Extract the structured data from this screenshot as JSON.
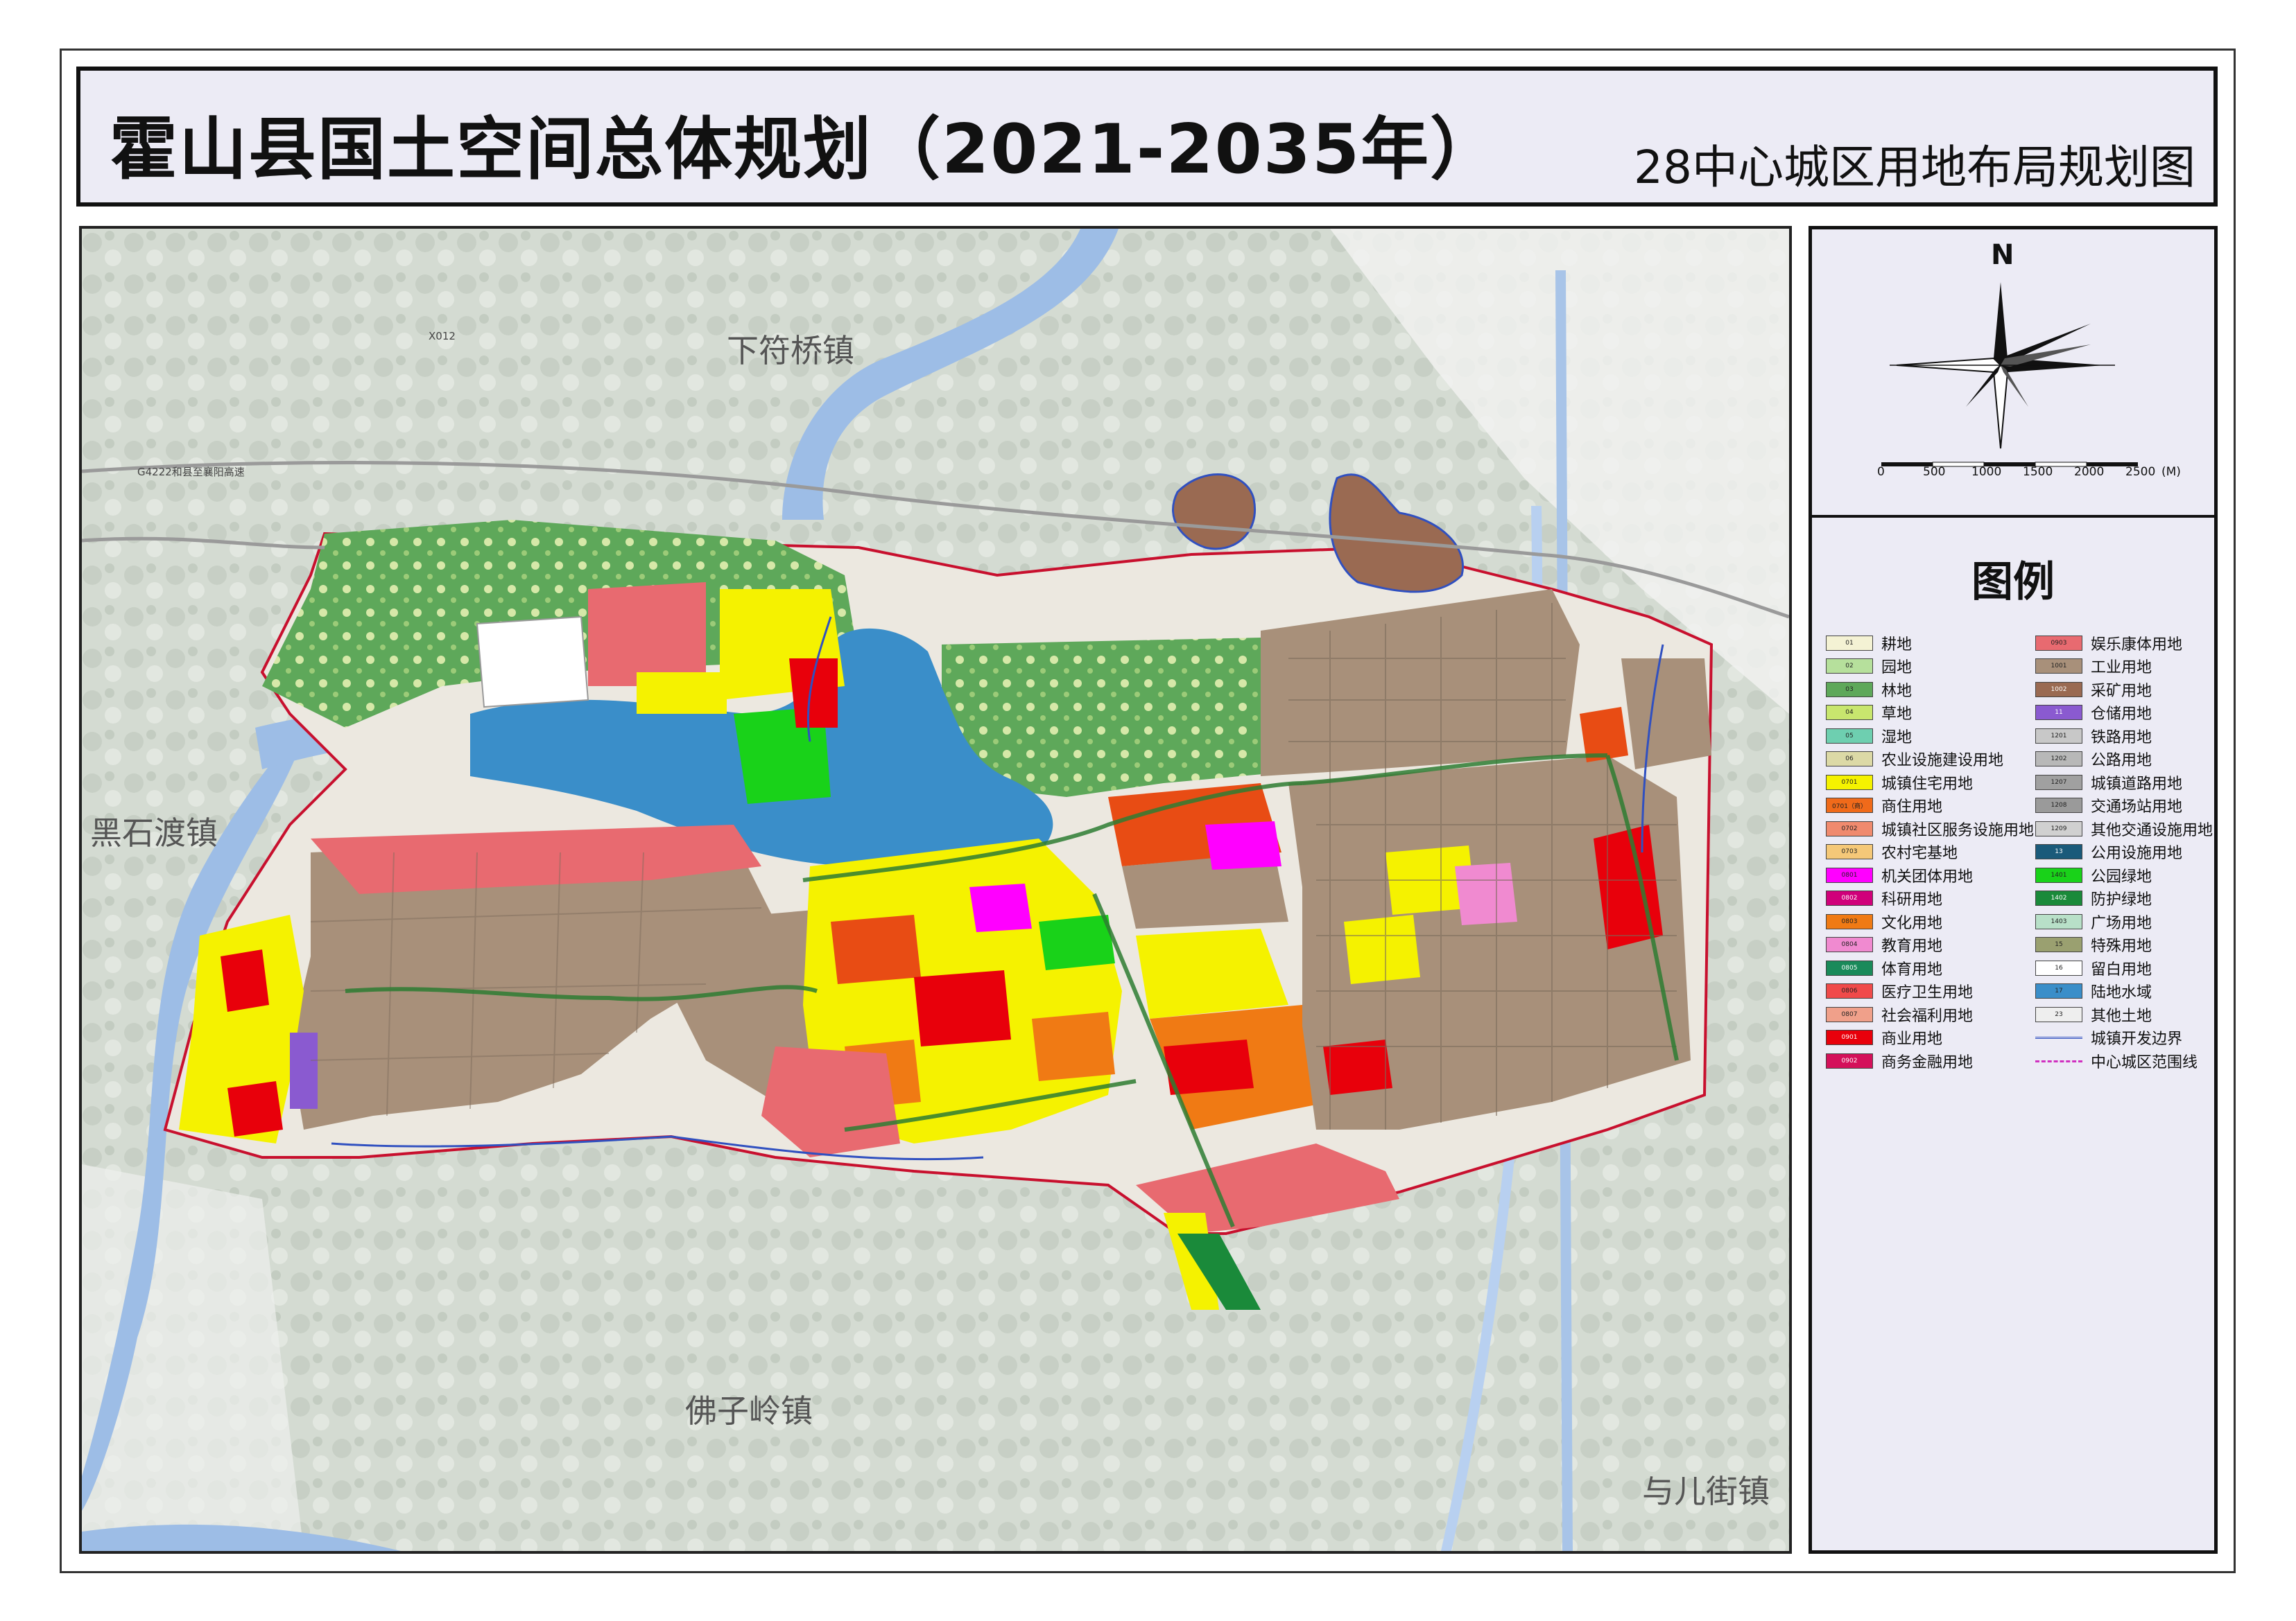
{
  "header": {
    "title": "霍山县国土空间总体规划（2021-2035年）",
    "subtitle": "28中心城区用地布局规划图"
  },
  "compass": {
    "north": "N"
  },
  "scale_bar": {
    "ticks": [
      "0",
      "500",
      "1000",
      "1500",
      "2000",
      "2500"
    ],
    "unit": "(M)"
  },
  "map": {
    "towns": [
      {
        "name": "下符桥镇"
      },
      {
        "name": "黑石渡镇"
      },
      {
        "name": "佛子岭镇"
      },
      {
        "name": "与儿街镇"
      }
    ],
    "roads": [
      {
        "name": "X012"
      },
      {
        "name": "G4222和县至襄阳高速"
      }
    ],
    "colors": {
      "water": "#9dbde6",
      "reservoir": "#3a8ec9",
      "forest": "#5ea85a",
      "industrial": "#a8907a",
      "residential": "#f5f200",
      "commercial": "#e8000b",
      "mixed": "#e84c14",
      "park": "#19d219",
      "boundary": "#c8102e",
      "road_outline": "#2e7d32",
      "dev_boundary": "#3050c0"
    }
  },
  "legend": {
    "title": "图例",
    "left": [
      {
        "code": "01",
        "label": "耕地",
        "color": "#f4f2d4"
      },
      {
        "code": "02",
        "label": "园地",
        "color": "#b6e09c"
      },
      {
        "code": "03",
        "label": "林地",
        "color": "#5ea85a"
      },
      {
        "code": "04",
        "label": "草地",
        "color": "#c8e66e"
      },
      {
        "code": "05",
        "label": "湿地",
        "color": "#6ecfb0"
      },
      {
        "code": "06",
        "label": "农业设施建设用地",
        "color": "#dcd9a6"
      },
      {
        "code": "0701",
        "label": "城镇住宅用地",
        "color": "#f5f200"
      },
      {
        "code": "0701（商）",
        "label": "商住用地",
        "color": "#f06a1a"
      },
      {
        "code": "0702",
        "label": "城镇社区服务设施用地",
        "color": "#f08a6e"
      },
      {
        "code": "0703",
        "label": "农村宅基地",
        "color": "#f5c878"
      },
      {
        "code": "0801",
        "label": "机关团体用地",
        "color": "#ff00ff"
      },
      {
        "code": "0802",
        "label": "科研用地",
        "color": "#d0007a"
      },
      {
        "code": "0803",
        "label": "文化用地",
        "color": "#f07a14"
      },
      {
        "code": "0804",
        "label": "教育用地",
        "color": "#f08ad0"
      },
      {
        "code": "0805",
        "label": "体育用地",
        "color": "#1a8a5a"
      },
      {
        "code": "0806",
        "label": "医疗卫生用地",
        "color": "#f04a4a"
      },
      {
        "code": "0807",
        "label": "社会福利用地",
        "color": "#f0a08a"
      },
      {
        "code": "0901",
        "label": "商业用地",
        "color": "#e8000b"
      },
      {
        "code": "0902",
        "label": "商务金融用地",
        "color": "#d4105a"
      }
    ],
    "right": [
      {
        "code": "0903",
        "label": "娱乐康体用地",
        "color": "#e86a70"
      },
      {
        "code": "1001",
        "label": "工业用地",
        "color": "#a8907a"
      },
      {
        "code": "1002",
        "label": "采矿用地",
        "color": "#9a6a52"
      },
      {
        "code": "11",
        "label": "仓储用地",
        "color": "#8a5ad0"
      },
      {
        "code": "1201",
        "label": "铁路用地",
        "color": "#c8c8c8"
      },
      {
        "code": "1202",
        "label": "公路用地",
        "color": "#b8b8b8"
      },
      {
        "code": "1207",
        "label": "城镇道路用地",
        "color": "#a0a0a0"
      },
      {
        "code": "1208",
        "label": "交通场站用地",
        "color": "#9a9a9a"
      },
      {
        "code": "1209",
        "label": "其他交通设施用地",
        "color": "#d0d0d0"
      },
      {
        "code": "13",
        "label": "公用设施用地",
        "color": "#1a5a7a"
      },
      {
        "code": "1401",
        "label": "公园绿地",
        "color": "#19d219"
      },
      {
        "code": "1402",
        "label": "防护绿地",
        "color": "#1a8a3a"
      },
      {
        "code": "1403",
        "label": "广场用地",
        "color": "#b8e0c8"
      },
      {
        "code": "15",
        "label": "特殊用地",
        "color": "#9aa070"
      },
      {
        "code": "16",
        "label": "留白用地",
        "color": "#ffffff"
      },
      {
        "code": "17",
        "label": "陆地水域",
        "color": "#3a8ec9"
      },
      {
        "code": "23",
        "label": "其他土地",
        "color": "#eeeeee"
      },
      {
        "code": "",
        "label": "城镇开发边界",
        "color": "#3050c0"
      },
      {
        "code": "",
        "label": "中心城区范围线",
        "color": "#d030c0"
      }
    ]
  }
}
